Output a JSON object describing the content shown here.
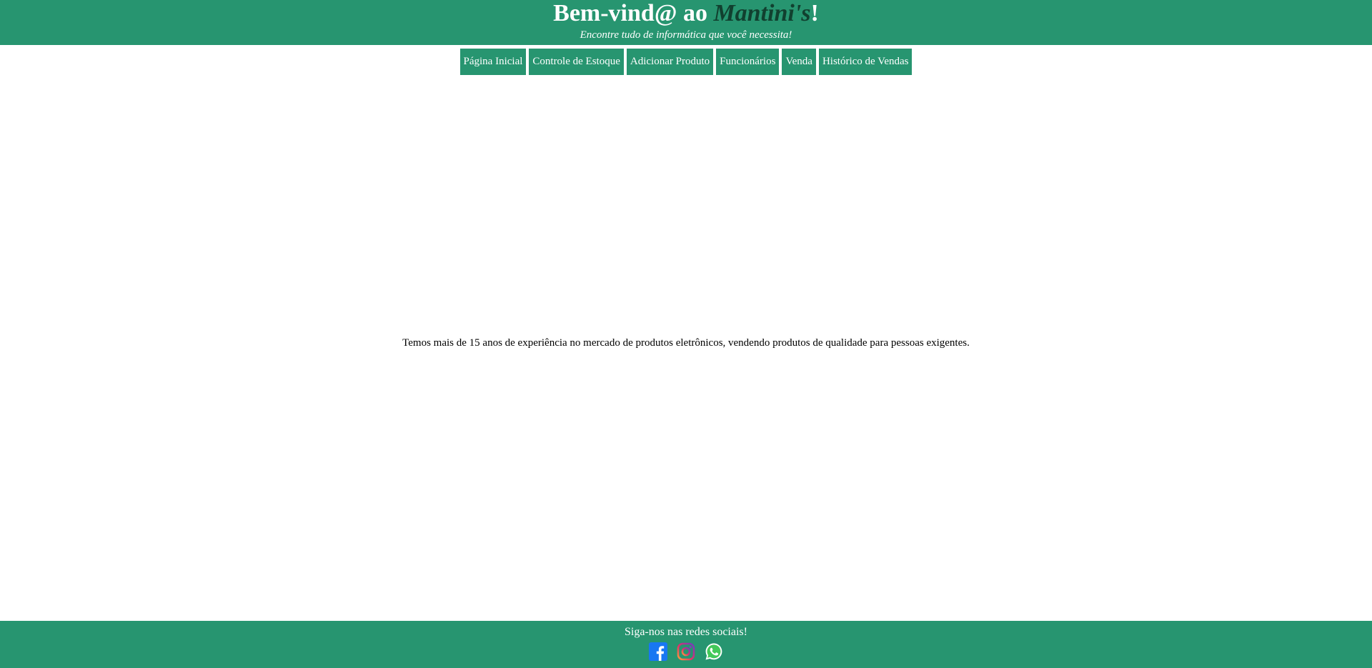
{
  "header": {
    "title_prefix": "Bem-vind@ ao ",
    "brand": "Mantini's",
    "title_suffix": "!",
    "subtitle": "Encontre tudo de informática que você necessita!"
  },
  "nav": {
    "items": [
      {
        "label": "Página Inicial"
      },
      {
        "label": "Controle de Estoque"
      },
      {
        "label": "Adicionar Produto"
      },
      {
        "label": "Funcionários"
      },
      {
        "label": "Venda"
      },
      {
        "label": "Histórico de Vendas"
      }
    ]
  },
  "main": {
    "about_text": "Temos mais de 15 anos de experiência no mercado de produtos eletrônicos, vendendo produtos de qualidade para pessoas exigentes."
  },
  "footer": {
    "text": "Siga-nos nas redes sociais!",
    "socials": [
      {
        "icon": "facebook-icon"
      },
      {
        "icon": "instagram-icon"
      },
      {
        "icon": "whatsapp-icon"
      }
    ]
  },
  "colors": {
    "primary": "#279570",
    "brand_dark": "#11402f",
    "text": "#000000",
    "on_primary": "#ffffff"
  }
}
